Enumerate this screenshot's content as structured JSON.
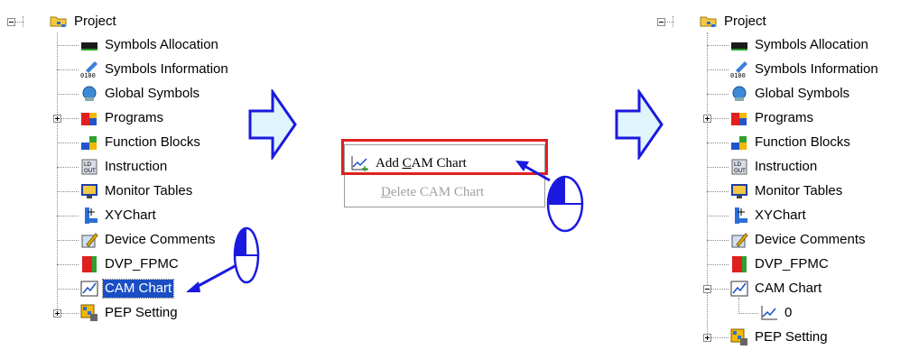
{
  "left_tree": {
    "root": "Project",
    "items": [
      {
        "label": "Symbols Allocation",
        "icon": "symbols-allocation-icon"
      },
      {
        "label": "Symbols Information",
        "icon": "symbols-information-icon"
      },
      {
        "label": "Global Symbols",
        "icon": "global-symbols-icon"
      },
      {
        "label": "Programs",
        "icon": "programs-icon"
      },
      {
        "label": "Function Blocks",
        "icon": "function-blocks-icon"
      },
      {
        "label": "Instruction",
        "icon": "instruction-icon"
      },
      {
        "label": "Monitor Tables",
        "icon": "monitor-tables-icon"
      },
      {
        "label": "XYChart",
        "icon": "xychart-icon"
      },
      {
        "label": "Device Comments",
        "icon": "device-comments-icon"
      },
      {
        "label": "DVP_FPMC",
        "icon": "dvp-fpmc-icon"
      },
      {
        "label": "CAM Chart",
        "icon": "cam-chart-icon"
      },
      {
        "label": "PEP Setting",
        "icon": "pep-setting-icon"
      }
    ]
  },
  "context_menu": {
    "add_label_pre": "Add ",
    "add_label_key": "C",
    "add_label_post": "AM Chart",
    "delete_label_key": "D",
    "delete_label_post": "elete CAM Chart"
  },
  "right_tree": {
    "root": "Project",
    "items": [
      {
        "label": "Symbols Allocation"
      },
      {
        "label": "Symbols Information"
      },
      {
        "label": "Global Symbols"
      },
      {
        "label": "Programs"
      },
      {
        "label": "Function Blocks"
      },
      {
        "label": "Instruction"
      },
      {
        "label": "Monitor Tables"
      },
      {
        "label": "XYChart"
      },
      {
        "label": "Device Comments"
      },
      {
        "label": "DVP_FPMC"
      },
      {
        "label": "CAM Chart"
      },
      {
        "label": "0"
      },
      {
        "label": "PEP Setting"
      }
    ]
  },
  "colors": {
    "selection": "#1a4fc4",
    "highlight": "#e02020",
    "arrow": "#1a1adf",
    "arrow_fill": "#e0f4fb"
  }
}
